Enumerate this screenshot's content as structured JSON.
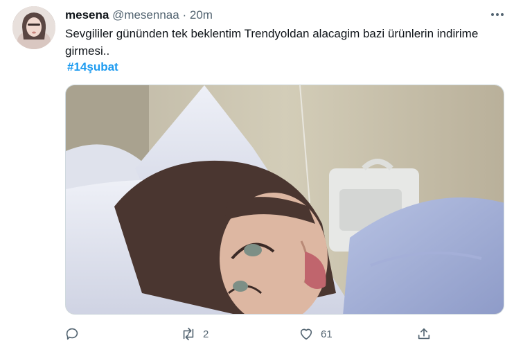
{
  "tweet": {
    "display_name": "mesena",
    "handle": "@mesennaa",
    "separator": "·",
    "time": "20m",
    "text": "Sevgililer gününden tek beklentim Trendyoldan alacagim bazi ürünlerin indirime girmesi..",
    "hashtag": "#14şubat",
    "retweet_count": "2",
    "like_count": "61"
  },
  "icons": {
    "more": "more-dots-icon",
    "reply": "reply-icon",
    "retweet": "retweet-icon",
    "like": "heart-icon",
    "share": "share-icon"
  },
  "colors": {
    "link": "#1d9bf0",
    "secondary_text": "#536471",
    "primary_text": "#0f1419"
  }
}
